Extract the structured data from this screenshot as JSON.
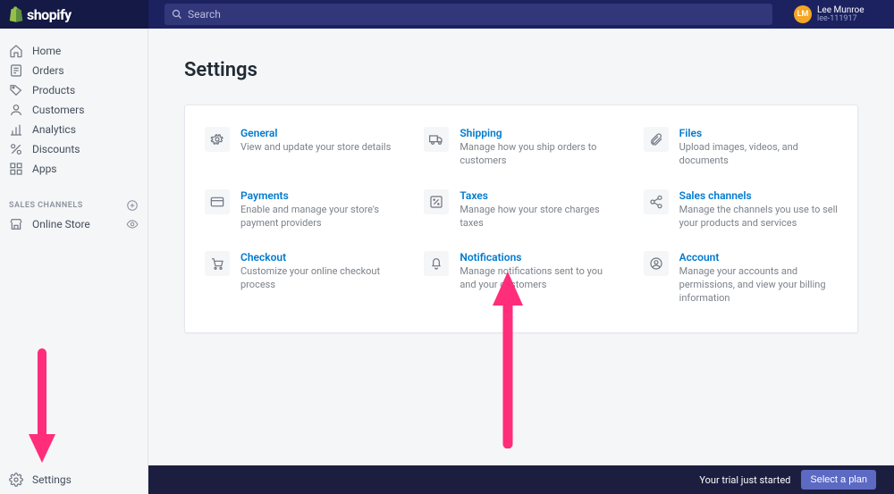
{
  "brand": "shopify",
  "search": {
    "placeholder": "Search"
  },
  "user": {
    "initials": "LM",
    "name": "Lee Munroe",
    "sub": "lee-111917"
  },
  "nav": {
    "items": [
      {
        "label": "Home"
      },
      {
        "label": "Orders"
      },
      {
        "label": "Products"
      },
      {
        "label": "Customers"
      },
      {
        "label": "Analytics"
      },
      {
        "label": "Discounts"
      },
      {
        "label": "Apps"
      }
    ],
    "section_label": "SALES CHANNELS",
    "channel": "Online Store",
    "settings_label": "Settings"
  },
  "page": {
    "title": "Settings"
  },
  "tiles": [
    {
      "title": "General",
      "desc": "View and update your store details"
    },
    {
      "title": "Shipping",
      "desc": "Manage how you ship orders to customers"
    },
    {
      "title": "Files",
      "desc": "Upload images, videos, and documents"
    },
    {
      "title": "Payments",
      "desc": "Enable and manage your store's payment providers"
    },
    {
      "title": "Taxes",
      "desc": "Manage how your store charges taxes"
    },
    {
      "title": "Sales channels",
      "desc": "Manage the channels you use to sell your products and services"
    },
    {
      "title": "Checkout",
      "desc": "Customize your online checkout process"
    },
    {
      "title": "Notifications",
      "desc": "Manage notifications sent to you and your customers"
    },
    {
      "title": "Account",
      "desc": "Manage your accounts and permissions, and view your billing information"
    }
  ],
  "trial": {
    "text": "Your trial just started",
    "button": "Select a plan"
  },
  "colors": {
    "link": "#007ace",
    "accent": "#5c6ac4"
  }
}
